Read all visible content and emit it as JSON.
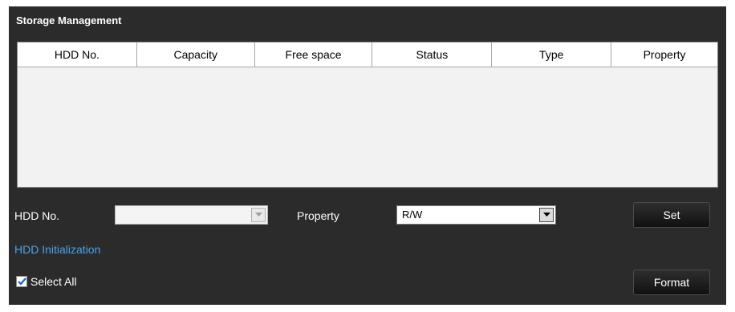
{
  "panel": {
    "title": "Storage Management"
  },
  "table": {
    "columns": [
      "HDD No.",
      "Capacity",
      "Free space",
      "Status",
      "Type",
      "Property"
    ],
    "rows": []
  },
  "form": {
    "hdd_no_label": "HDD No.",
    "hdd_no_value": "",
    "property_label": "Property",
    "property_value": "R/W",
    "set_label": "Set",
    "hdd_init_label": "HDD Initialization",
    "select_all_label": "Select All",
    "select_all_checked": true,
    "format_label": "Format"
  },
  "icons": {
    "dropdown": "chevron-down-icon",
    "check": "check-icon"
  },
  "colors": {
    "panel_bg": "#2b2b2b",
    "link": "#4aa3e6",
    "checkbox_check": "#1f5fbf"
  }
}
